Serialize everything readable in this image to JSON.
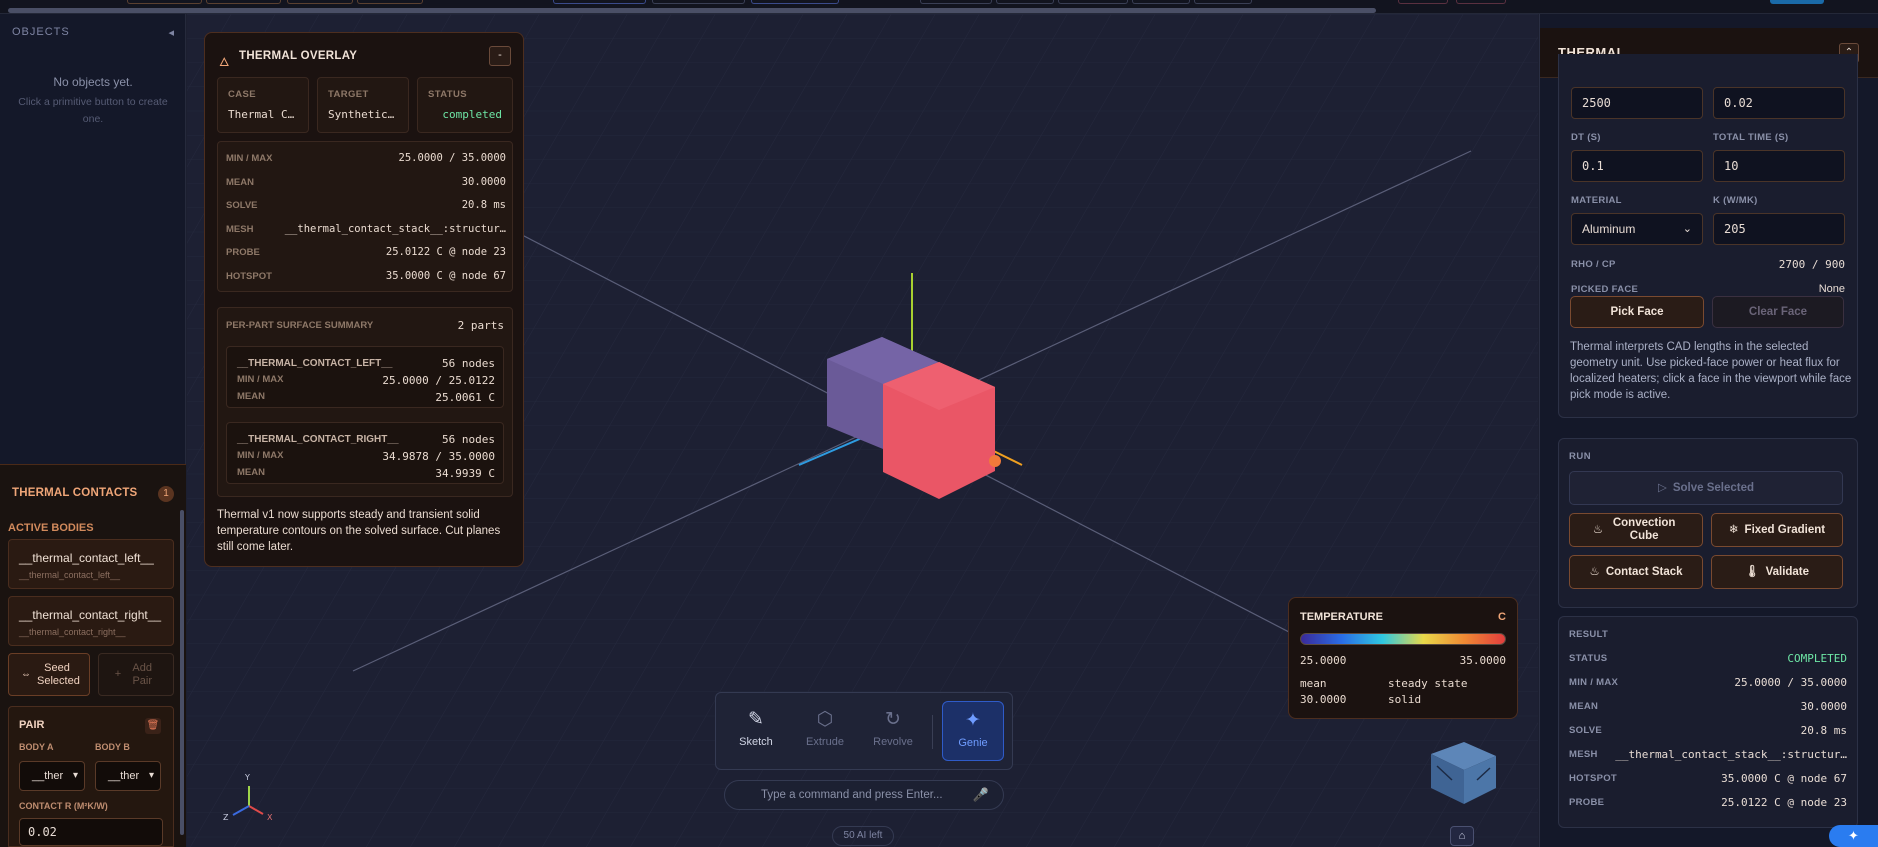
{
  "left_panel": {
    "objects_title": "OBJECTS",
    "collapse_icon": "◂",
    "empty_text": "No objects yet.",
    "empty_hint": "Click a primitive button to create one."
  },
  "contacts": {
    "title": "THERMAL CONTACTS",
    "count": "1",
    "active_bodies_label": "ACTIVE BODIES",
    "bodies": [
      {
        "name": "__thermal_contact_left__",
        "sub": "__thermal_contact_left__"
      },
      {
        "name": "__thermal_contact_right__",
        "sub": "__thermal_contact_right__"
      }
    ],
    "seed_label": "Seed Selected",
    "add_pair_label": "Add Pair",
    "pair_label": "PAIR",
    "body_a_label": "BODY A",
    "body_b_label": "BODY B",
    "body_a_value": "__ther",
    "body_b_value": "__ther",
    "contact_r_label": "CONTACT R (M²K/W)",
    "contact_r_value": "0.02"
  },
  "overlay": {
    "title": "THERMAL OVERLAY",
    "minimize_label": "-",
    "case_label": "CASE",
    "case_value": "Thermal C…",
    "target_label": "TARGET",
    "target_value": "Synthetic…",
    "status_label": "STATUS",
    "status_value": "completed",
    "stats": [
      {
        "label": "MIN / MAX",
        "value": "25.0000 / 35.0000"
      },
      {
        "label": "MEAN",
        "value": "30.0000"
      },
      {
        "label": "SOLVE",
        "value": "20.8 ms"
      },
      {
        "label": "MESH",
        "value": "__thermal_contact_stack__:structur…"
      },
      {
        "label": "PROBE",
        "value": "25.0122 C @ node 23"
      },
      {
        "label": "HOTSPOT",
        "value": "35.0000 C @ node 67"
      }
    ],
    "parts_title": "PER-PART SURFACE SUMMARY",
    "parts_count": "2 parts",
    "parts": [
      {
        "name": "__THERMAL_CONTACT_LEFT__",
        "nodes": "56 nodes",
        "minmax_label": "MIN / MAX",
        "minmax": "25.0000 / 25.0122",
        "mean_label": "MEAN",
        "mean": "25.0061 C"
      },
      {
        "name": "__THERMAL_CONTACT_RIGHT__",
        "nodes": "56 nodes",
        "minmax_label": "MIN / MAX",
        "minmax": "34.9878 / 35.0000",
        "mean_label": "MEAN",
        "mean": "34.9939 C"
      }
    ],
    "note": "Thermal v1 now supports steady and transient solid temperature contours on the solved surface. Cut planes still come later."
  },
  "temperature_legend": {
    "title": "TEMPERATURE",
    "unit": "C",
    "min": "25.0000",
    "max": "35.0000",
    "mean_label": "mean",
    "mean_value": "30.0000",
    "mode": "steady state",
    "type": "solid"
  },
  "toolbar": {
    "sketch": "Sketch",
    "extrude": "Extrude",
    "revolve": "Revolve",
    "genie": "Genie"
  },
  "command": {
    "placeholder": "Type a command and press Enter...",
    "ai_left": "50 AI left"
  },
  "axis_triad": {
    "x": "X",
    "y": "Y",
    "z": "Z"
  },
  "right_panel": {
    "title": "THERMAL",
    "collapse_icon": "⌃",
    "input_row1": [
      "2500",
      "0.02"
    ],
    "dt_label": "DT (S)",
    "dt_value": "0.1",
    "total_time_label": "TOTAL TIME (S)",
    "total_time_value": "10",
    "material_label": "MATERIAL",
    "material_value": "Aluminum",
    "k_label": "K (W/MK)",
    "k_value": "205",
    "rho_cp_label": "RHO / CP",
    "rho_cp_value": "2700 / 900",
    "picked_face_label": "PICKED FACE",
    "picked_face_value": "None",
    "pick_face_label": "Pick Face",
    "clear_face_label": "Clear Face",
    "help": "Thermal interprets CAD lengths in the selected geometry unit. Use picked-face power or heat flux for localized heaters; click a face in the viewport while face pick mode is active.",
    "run_title": "RUN",
    "solve_selected": "Solve Selected",
    "convection_cube": "Convection Cube",
    "fixed_gradient": "Fixed Gradient",
    "contact_stack": "Contact Stack",
    "validate": "Validate",
    "result_title": "RESULT",
    "result": [
      {
        "label": "STATUS",
        "value": "COMPLETED"
      },
      {
        "label": "MIN / MAX",
        "value": "25.0000 / 35.0000"
      },
      {
        "label": "MEAN",
        "value": "30.0000"
      },
      {
        "label": "SOLVE",
        "value": "20.8 ms"
      },
      {
        "label": "MESH",
        "value": "__thermal_contact_stack__:structur…"
      },
      {
        "label": "HOTSPOT",
        "value": "35.0000 C @ node 67"
      },
      {
        "label": "PROBE",
        "value": "25.0122 C @ node 23"
      }
    ]
  },
  "colors": {
    "accent_orange": "#f0a678",
    "status_green": "#6ee7a6",
    "genie_blue": "#6f9cff",
    "cube_left": "#6c5a9a",
    "cube_right": "#e85565"
  }
}
